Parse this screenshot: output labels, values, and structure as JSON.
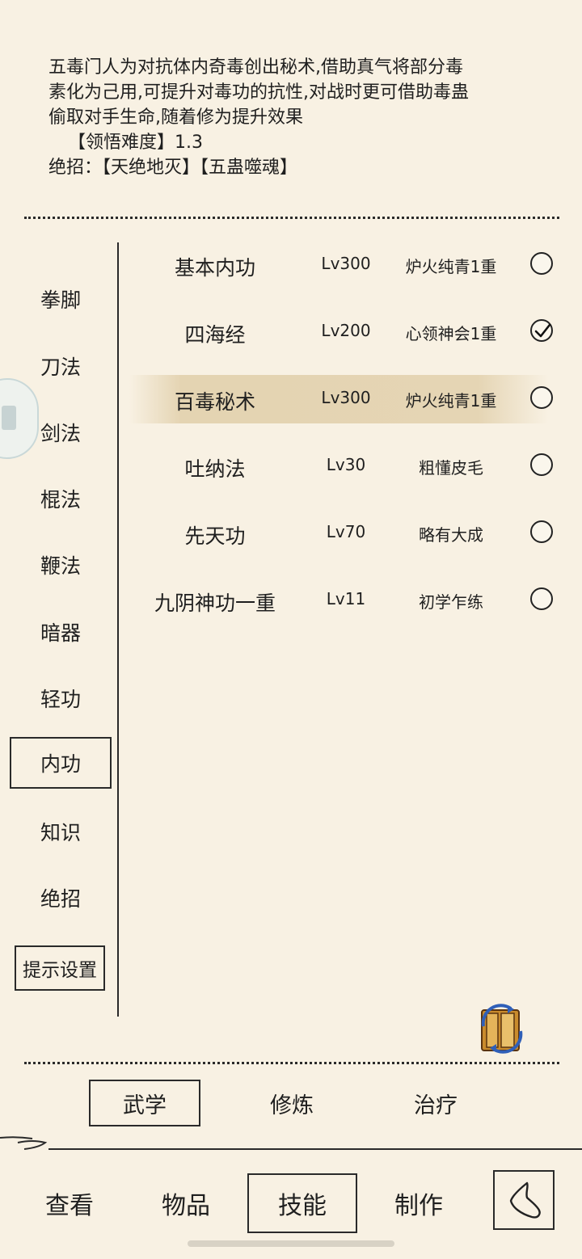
{
  "description": {
    "lines": [
      "五毒门人为对抗体内奇毒创出秘术,借助真气将部分毒",
      "素化为己用,可提升对毒功的抗性,对战时更可借助毒蛊",
      "偷取对手生命,随着修为提升效果"
    ],
    "difficulty": "【领悟难度】1.3",
    "ultimate": "绝招：【天绝地灭】【五蛊噬魂】"
  },
  "categories": [
    "拳脚",
    "刀法",
    "剑法",
    "棍法",
    "鞭法",
    "暗器",
    "轻功",
    "内功",
    "知识",
    "绝招"
  ],
  "active_category": "内功",
  "hint_settings": "提示设置",
  "skills": [
    {
      "name": "基本内功",
      "level": "Lv300",
      "rank": "炉火纯青1重",
      "checked": false
    },
    {
      "name": "四海经",
      "level": "Lv200",
      "rank": "心领神会1重",
      "checked": true
    },
    {
      "name": "百毒秘术",
      "level": "Lv300",
      "rank": "炉火纯青1重",
      "checked": false,
      "highlighted": true
    },
    {
      "name": "吐纳法",
      "level": "Lv30",
      "rank": "粗懂皮毛",
      "checked": false
    },
    {
      "name": "先天功",
      "level": "Lv70",
      "rank": "略有大成",
      "checked": false
    },
    {
      "name": "九阴神功一重",
      "level": "Lv11",
      "rank": "初学乍练",
      "checked": false
    }
  ],
  "subtabs": [
    "武学",
    "修炼",
    "治疗"
  ],
  "active_subtab": "武学",
  "nav": [
    "查看",
    "物品",
    "技能",
    "制作"
  ],
  "active_nav": "技能",
  "icons": {
    "radio_checked": "checkmark-icon",
    "book": "skill-book-swap-icon",
    "back": "back-arrow-icon"
  },
  "colors": {
    "background": "#f8f1e3",
    "ink": "#1f1f1f",
    "highlight": "#e3d2af"
  }
}
